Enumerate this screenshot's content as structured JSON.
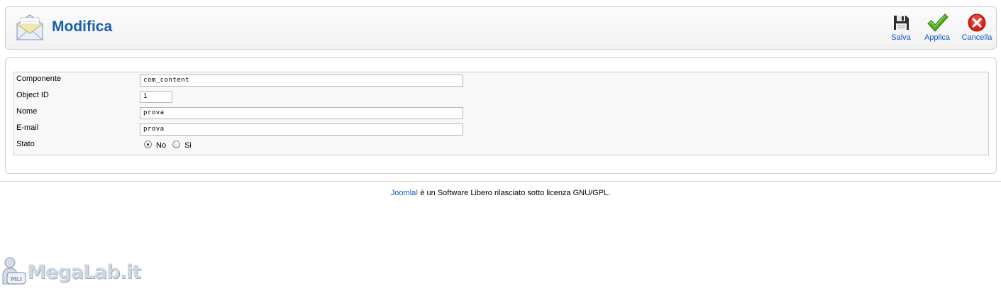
{
  "header": {
    "title": "Modifica",
    "icon": "envelope-icon"
  },
  "toolbar": {
    "save_label": "Salva",
    "apply_label": "Applica",
    "cancel_label": "Cancella"
  },
  "form": {
    "component_label": "Componente",
    "component_value": "com_content",
    "object_id_label": "Object ID",
    "object_id_value": "1",
    "name_label": "Nome",
    "name_value": "prova",
    "email_label": "E-mail",
    "email_value": "prova",
    "state_label": "Stato",
    "state_options": [
      "No",
      "Si"
    ],
    "state_selected": "No"
  },
  "footer": {
    "link_text": "Joomla!",
    "text": " è un Software Libero rilasciato sotto licenza GNU/GPL."
  },
  "watermark": {
    "text": "MegaLab.it",
    "badge": "MLI"
  },
  "colors": {
    "title": "#1d5fa8",
    "link": "#0b55c4",
    "apply_green": "#4caf1f",
    "cancel_red": "#d9221c"
  }
}
